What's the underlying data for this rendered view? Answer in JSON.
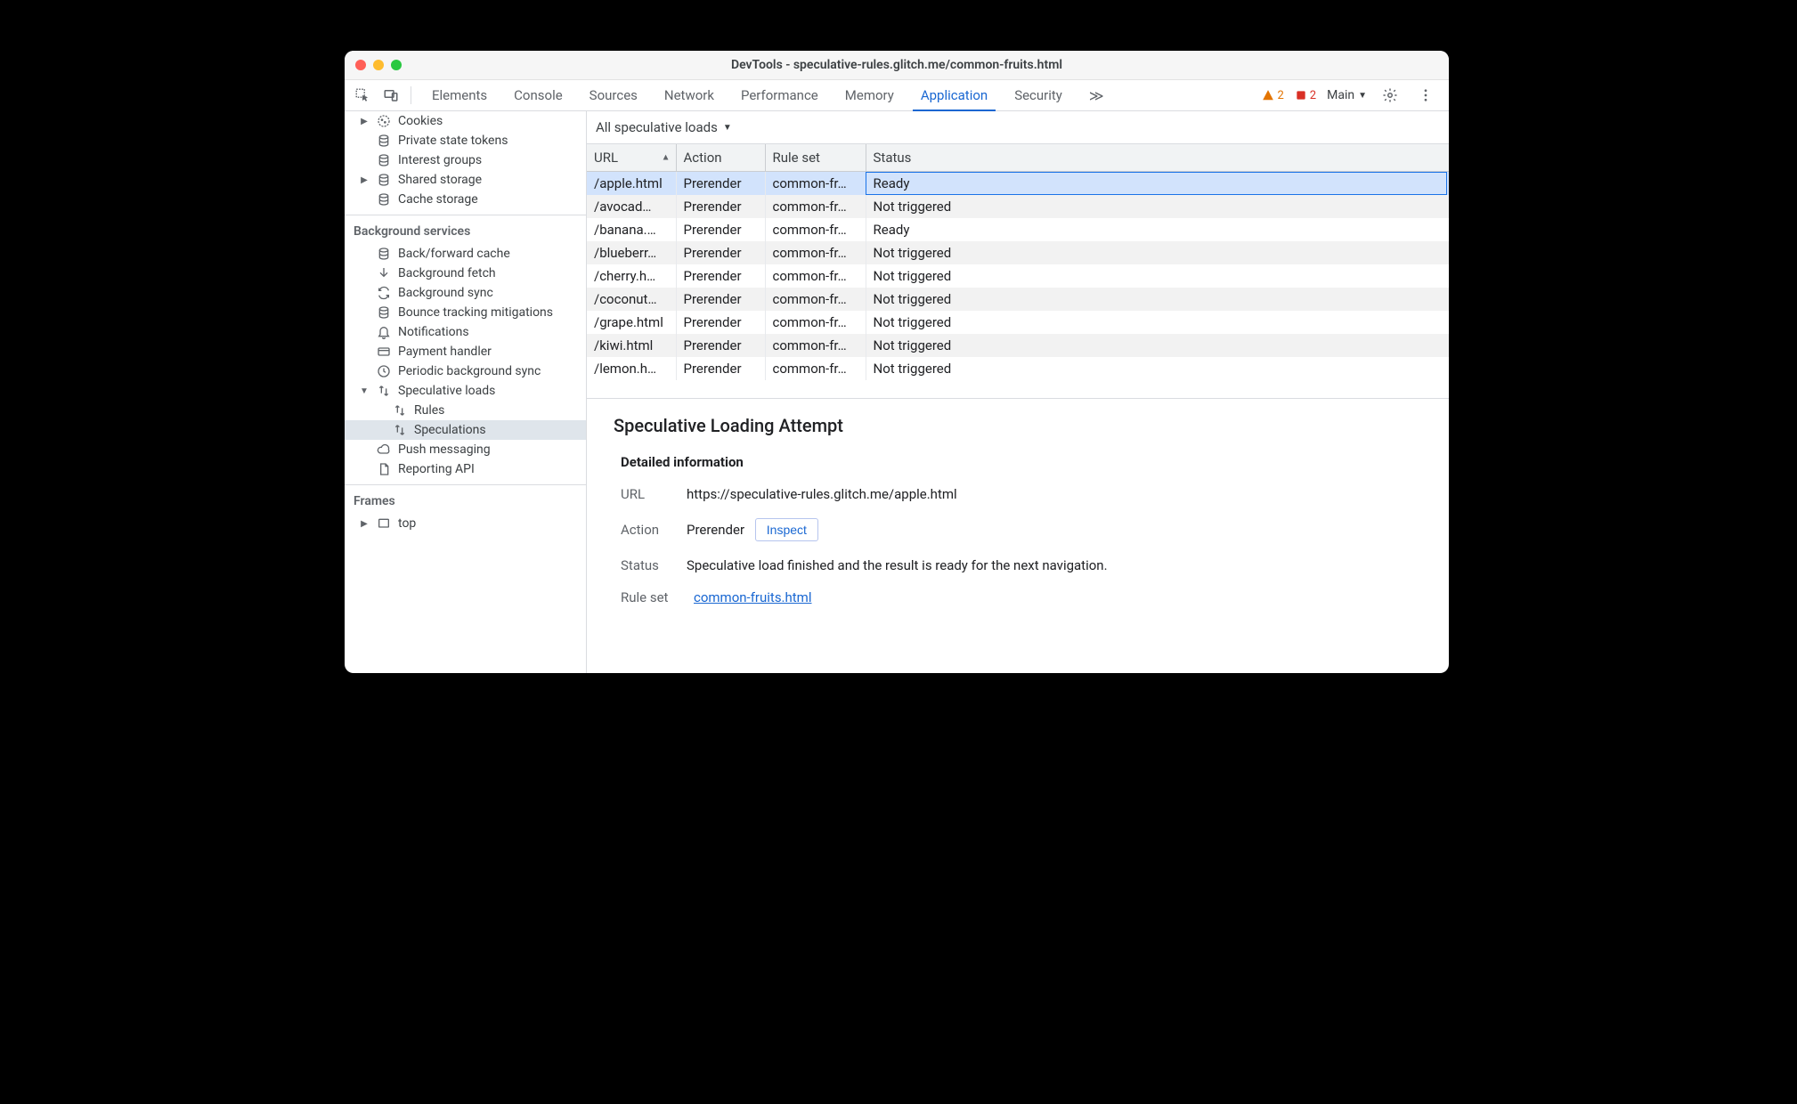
{
  "window_title": "DevTools - speculative-rules.glitch.me/common-fruits.html",
  "tabs": [
    "Elements",
    "Console",
    "Sources",
    "Network",
    "Performance",
    "Memory",
    "Application",
    "Security"
  ],
  "active_tab": "Application",
  "overflow_indicator": "≫",
  "issue_counts": {
    "warnings": "2",
    "errors": "2"
  },
  "context_selector": "Main",
  "sidebar": {
    "storage_items": [
      {
        "label": "Cookies",
        "icon": "cookie",
        "expandable": true
      },
      {
        "label": "Private state tokens",
        "icon": "db"
      },
      {
        "label": "Interest groups",
        "icon": "db"
      },
      {
        "label": "Shared storage",
        "icon": "db",
        "expandable": true
      },
      {
        "label": "Cache storage",
        "icon": "db"
      }
    ],
    "bg_header": "Background services",
    "bg_items": [
      {
        "label": "Back/forward cache",
        "icon": "db"
      },
      {
        "label": "Background fetch",
        "icon": "arrow-down"
      },
      {
        "label": "Background sync",
        "icon": "sync"
      },
      {
        "label": "Bounce tracking mitigations",
        "icon": "db"
      },
      {
        "label": "Notifications",
        "icon": "bell"
      },
      {
        "label": "Payment handler",
        "icon": "card"
      },
      {
        "label": "Periodic background sync",
        "icon": "clock"
      },
      {
        "label": "Speculative loads",
        "icon": "swap",
        "expandable": true,
        "expanded": true,
        "children": [
          {
            "label": "Rules",
            "icon": "swap"
          },
          {
            "label": "Speculations",
            "icon": "swap",
            "selected": true
          }
        ]
      },
      {
        "label": "Push messaging",
        "icon": "cloud"
      },
      {
        "label": "Reporting API",
        "icon": "page"
      }
    ],
    "frames_header": "Frames",
    "frames_items": [
      {
        "label": "top",
        "icon": "frame",
        "expandable": true
      }
    ]
  },
  "filter_label": "All speculative loads",
  "columns": [
    "URL",
    "Action",
    "Rule set",
    "Status"
  ],
  "rows": [
    {
      "url": "/apple.html",
      "action": "Prerender",
      "ruleset": "common-fr…",
      "status": "Ready",
      "selected": true
    },
    {
      "url": "/avocad…",
      "action": "Prerender",
      "ruleset": "common-fr…",
      "status": "Not triggered"
    },
    {
      "url": "/banana.…",
      "action": "Prerender",
      "ruleset": "common-fr…",
      "status": "Ready"
    },
    {
      "url": "/blueberr…",
      "action": "Prerender",
      "ruleset": "common-fr…",
      "status": "Not triggered"
    },
    {
      "url": "/cherry.h…",
      "action": "Prerender",
      "ruleset": "common-fr…",
      "status": "Not triggered"
    },
    {
      "url": "/coconut…",
      "action": "Prerender",
      "ruleset": "common-fr…",
      "status": "Not triggered"
    },
    {
      "url": "/grape.html",
      "action": "Prerender",
      "ruleset": "common-fr…",
      "status": "Not triggered"
    },
    {
      "url": "/kiwi.html",
      "action": "Prerender",
      "ruleset": "common-fr…",
      "status": "Not triggered"
    },
    {
      "url": "/lemon.h…",
      "action": "Prerender",
      "ruleset": "common-fr…",
      "status": "Not triggered"
    }
  ],
  "detail": {
    "heading": "Speculative Loading Attempt",
    "subheading": "Detailed information",
    "url_label": "URL",
    "url_value": "https://speculative-rules.glitch.me/apple.html",
    "action_label": "Action",
    "action_value": "Prerender",
    "inspect_label": "Inspect",
    "status_label": "Status",
    "status_value": "Speculative load finished and the result is ready for the next navigation.",
    "ruleset_label": "Rule set",
    "ruleset_link": "common-fruits.html"
  }
}
